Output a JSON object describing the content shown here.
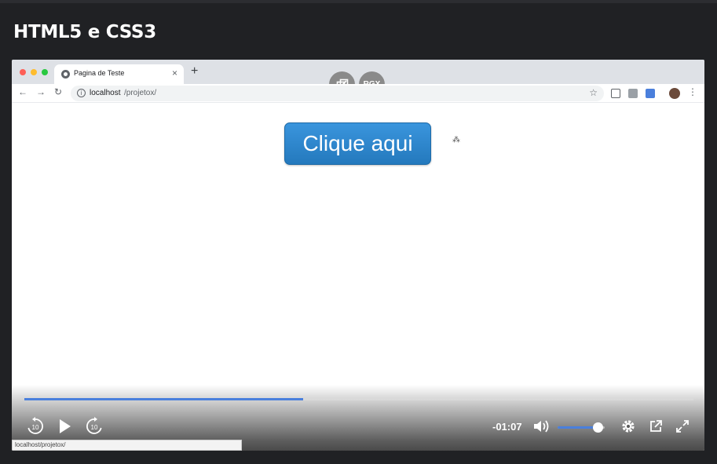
{
  "heading": "HTML5 e CSS3",
  "browser": {
    "tab_title": "Pagina de Teste",
    "tab_close": "×",
    "new_tab": "+",
    "url_host": "localhost",
    "url_path": "/projetox/",
    "info": "i"
  },
  "overlay": {
    "rgx_label": "RGX"
  },
  "page": {
    "button_label": "Clique aqui"
  },
  "player": {
    "time_remaining": "-01:07",
    "progress": 0.417,
    "volume": 0.85,
    "skip_back_label": "10",
    "skip_forward_label": "10",
    "accent_color": "#4a7fdc"
  },
  "status_bar": {
    "url": "localhost/projetox/"
  },
  "icons": {
    "back": "back-arrow-icon",
    "forward": "forward-arrow-icon",
    "reload": "reload-icon",
    "star": "star-icon",
    "menu": "kebab-menu-icon",
    "play": "play-icon",
    "volume": "volume-icon",
    "settings": "gear-icon",
    "external": "external-link-icon",
    "fullscreen": "fullscreen-icon"
  }
}
